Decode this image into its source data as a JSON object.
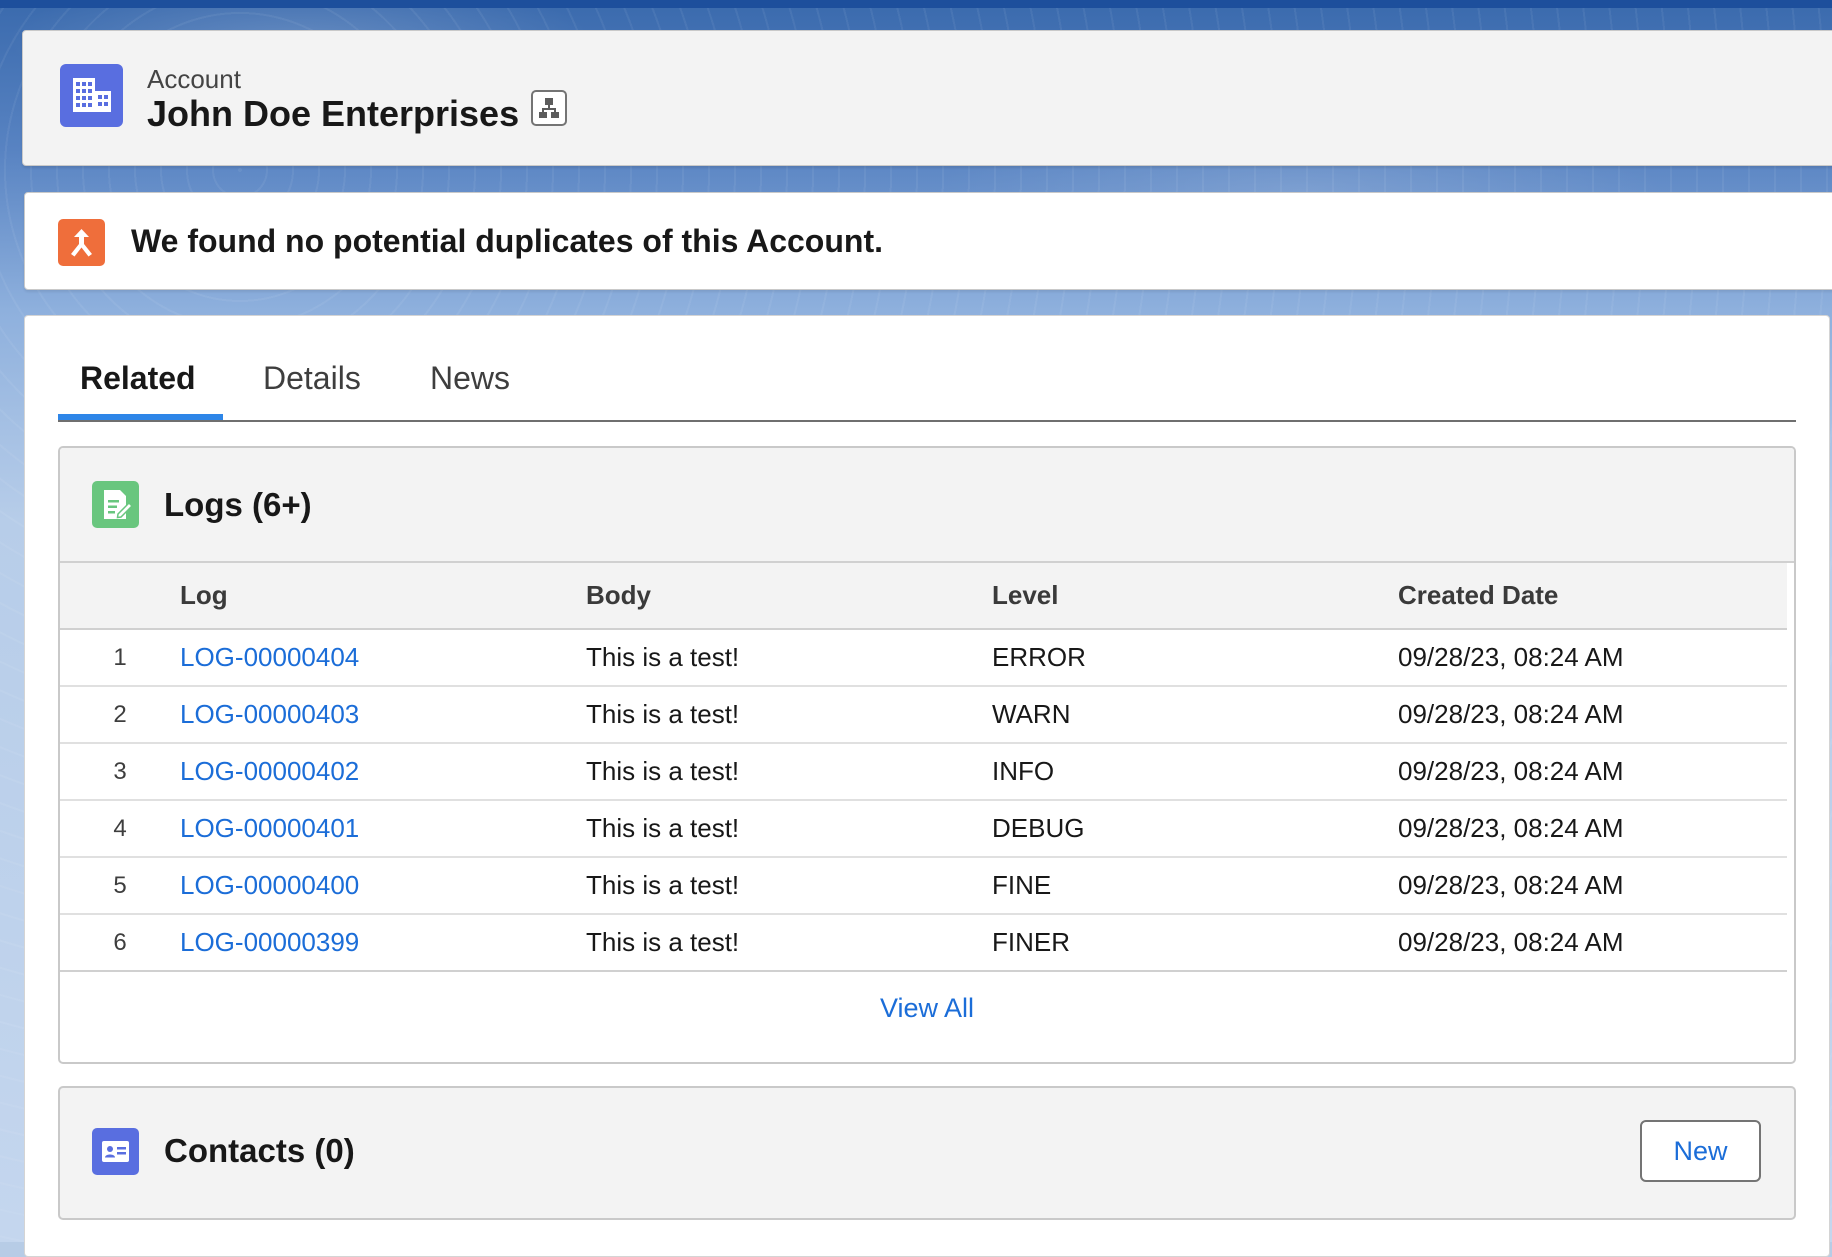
{
  "header": {
    "object_label": "Account",
    "record_name": "John Doe Enterprises",
    "object_icon": "account-building-icon",
    "hierarchy_icon": "hierarchy-icon"
  },
  "duplicates": {
    "icon": "merge-icon",
    "message": "We found no potential duplicates of this Account."
  },
  "tabs": [
    {
      "label": "Related",
      "active": true
    },
    {
      "label": "Details",
      "active": false
    },
    {
      "label": "News",
      "active": false
    }
  ],
  "logs": {
    "title": "Logs (6+)",
    "icon": "log-document-icon",
    "columns": [
      "Log",
      "Body",
      "Level",
      "Created Date"
    ],
    "rows": [
      {
        "num": "1",
        "log": "LOG-00000404",
        "body": "This is a test!",
        "level": "ERROR",
        "created": "09/28/23, 08:24 AM"
      },
      {
        "num": "2",
        "log": "LOG-00000403",
        "body": "This is a test!",
        "level": "WARN",
        "created": "09/28/23, 08:24 AM"
      },
      {
        "num": "3",
        "log": "LOG-00000402",
        "body": "This is a test!",
        "level": "INFO",
        "created": "09/28/23, 08:24 AM"
      },
      {
        "num": "4",
        "log": "LOG-00000401",
        "body": "This is a test!",
        "level": "DEBUG",
        "created": "09/28/23, 08:24 AM"
      },
      {
        "num": "5",
        "log": "LOG-00000400",
        "body": "This is a test!",
        "level": "FINE",
        "created": "09/28/23, 08:24 AM"
      },
      {
        "num": "6",
        "log": "LOG-00000399",
        "body": "This is a test!",
        "level": "FINER",
        "created": "09/28/23, 08:24 AM"
      }
    ],
    "view_all_label": "View All"
  },
  "contacts": {
    "title": "Contacts (0)",
    "icon": "contact-card-icon",
    "new_label": "New"
  },
  "colors": {
    "account_icon": "#596ee0",
    "duplicate_icon": "#ef6e3b",
    "logs_icon": "#69c67e",
    "link": "#1b6dd8",
    "active_tab_underline": "#2e86e8",
    "top_bar": "#1d4f9c"
  }
}
